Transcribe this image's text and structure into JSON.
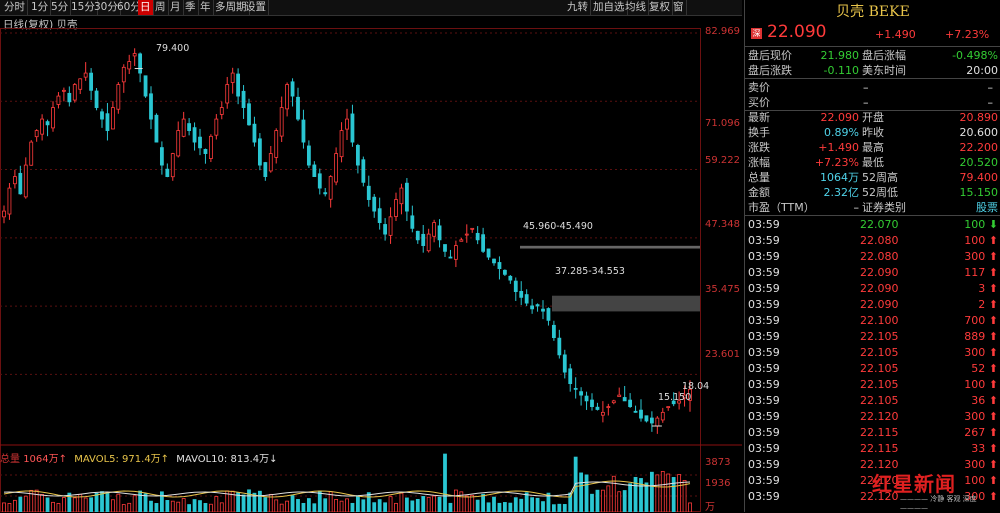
{
  "toolbar": {
    "left": [
      "分时",
      "1分",
      "5分",
      "15分",
      "30分",
      "60分",
      "日",
      "周",
      "月",
      "季",
      "年",
      "多周期",
      "设置"
    ],
    "active": "日",
    "right": [
      "九转",
      "加自选",
      "均线",
      "复权",
      "窗"
    ]
  },
  "chart": {
    "title": "日线(复权) 贝壳",
    "price_labels": [
      "82.969",
      "71.096",
      "59.222",
      "47.348",
      "35.475",
      "23.601"
    ],
    "annotations": {
      "high": "79.400",
      "low": "15.150",
      "last": "18.04",
      "gap1": "45.960-45.490",
      "gap2": "37.285-34.553"
    },
    "volume_legend": {
      "total_label": "总量",
      "total_value": "1064万↑",
      "mavol5": "MAVOL5: 971.4万↑",
      "mavol10": "MAVOL10: 813.4万↓"
    },
    "volume_labels": [
      "3873",
      "1936"
    ],
    "volume_unit": "万"
  },
  "chart_data": {
    "type": "candlestick",
    "title": "日线(复权) 贝壳",
    "ylim": [
      15.15,
      82.969
    ],
    "y_ticks": [
      82.969,
      71.096,
      59.222,
      47.348,
      35.475,
      23.601
    ],
    "series_close": [
      52,
      56,
      58,
      55,
      60,
      64,
      66,
      68,
      67,
      70,
      72,
      73,
      71,
      74,
      75,
      76,
      73,
      70,
      68,
      66,
      70,
      74,
      77,
      78,
      79.4,
      76,
      72,
      68,
      64,
      60,
      58,
      62,
      66,
      68,
      66,
      64,
      63,
      62,
      65,
      68,
      70,
      74,
      76,
      72,
      70,
      67,
      64,
      60,
      58,
      62,
      66,
      70,
      74,
      72,
      68,
      64,
      60,
      58,
      56,
      55,
      58,
      62,
      66,
      68,
      64,
      60,
      57,
      54,
      52,
      50,
      48,
      51,
      54,
      56,
      52,
      49,
      47,
      46,
      48,
      50,
      47,
      45,
      44,
      46,
      47,
      48,
      49,
      47,
      45,
      44,
      43,
      42,
      41,
      40,
      38,
      37,
      36,
      35,
      35.5,
      34.6,
      33,
      30,
      27,
      24,
      22,
      21,
      20,
      19,
      18,
      17.5,
      17,
      18,
      19,
      20,
      19,
      18,
      17,
      16,
      15.5,
      15.15,
      16,
      17,
      18,
      18.5,
      19,
      20,
      21
    ],
    "volume_ylim": [
      0,
      3873
    ],
    "volume_max_label": 3873
  },
  "panel": {
    "name": "贝壳 BEKE",
    "badge": "深",
    "price": "22.090",
    "change": "+1.490",
    "change_pct": "+7.23%",
    "after_hours": [
      {
        "l1": "盘后现价",
        "v1": "21.980",
        "l2": "盘后涨幅",
        "v2": "-0.498%"
      },
      {
        "l1": "盘后涨跌",
        "v1": "-0.110",
        "l2": "美东时间",
        "v2": "20:00"
      }
    ],
    "bid_ask": [
      {
        "label": "卖价",
        "v": "–",
        "v2": "–"
      },
      {
        "label": "买价",
        "v": "–",
        "v2": "–"
      }
    ],
    "stats": [
      {
        "l1": "最新",
        "v1": "22.090",
        "c1": "red",
        "l2": "开盘",
        "v2": "20.890",
        "c2": "red"
      },
      {
        "l1": "换手",
        "v1": "0.89%",
        "c1": "cyan",
        "l2": "昨收",
        "v2": "20.600",
        "c2": "white"
      },
      {
        "l1": "涨跌",
        "v1": "+1.490",
        "c1": "red",
        "l2": "最高",
        "v2": "22.200",
        "c2": "red"
      },
      {
        "l1": "涨幅",
        "v1": "+7.23%",
        "c1": "red",
        "l2": "最低",
        "v2": "20.520",
        "c2": "green"
      },
      {
        "l1": "总量",
        "v1": "1064万",
        "c1": "cyan",
        "l2": "52周高",
        "v2": "79.400",
        "c2": "red"
      },
      {
        "l1": "金额",
        "v1": "2.32亿",
        "c1": "cyan",
        "l2": "52周低",
        "v2": "15.150",
        "c2": "green"
      },
      {
        "l1": "市盈（TTM）",
        "v1": "–",
        "c1": "white",
        "l2": "证券类别",
        "v2": "股票",
        "c2": "cyan"
      }
    ],
    "trades": [
      {
        "t": "03:59",
        "p": "22.070",
        "v": "100",
        "d": "down"
      },
      {
        "t": "03:59",
        "p": "22.080",
        "v": "100",
        "d": "up"
      },
      {
        "t": "03:59",
        "p": "22.080",
        "v": "300",
        "d": "up"
      },
      {
        "t": "03:59",
        "p": "22.090",
        "v": "117",
        "d": "up"
      },
      {
        "t": "03:59",
        "p": "22.090",
        "v": "3",
        "d": "up"
      },
      {
        "t": "03:59",
        "p": "22.090",
        "v": "2",
        "d": "up"
      },
      {
        "t": "03:59",
        "p": "22.100",
        "v": "700",
        "d": "up"
      },
      {
        "t": "03:59",
        "p": "22.105",
        "v": "889",
        "d": "up"
      },
      {
        "t": "03:59",
        "p": "22.105",
        "v": "300",
        "d": "up"
      },
      {
        "t": "03:59",
        "p": "22.105",
        "v": "52",
        "d": "up"
      },
      {
        "t": "03:59",
        "p": "22.105",
        "v": "100",
        "d": "up"
      },
      {
        "t": "03:59",
        "p": "22.105",
        "v": "36",
        "d": "up"
      },
      {
        "t": "03:59",
        "p": "22.120",
        "v": "300",
        "d": "up"
      },
      {
        "t": "03:59",
        "p": "22.115",
        "v": "267",
        "d": "up"
      },
      {
        "t": "03:59",
        "p": "22.115",
        "v": "33",
        "d": "up"
      },
      {
        "t": "03:59",
        "p": "22.120",
        "v": "300",
        "d": "up"
      },
      {
        "t": "03:59",
        "p": "22.120",
        "v": "100",
        "d": "up"
      },
      {
        "t": "03:59",
        "p": "22.120",
        "v": "300",
        "d": "up"
      }
    ]
  },
  "watermark": {
    "main": "红星新闻",
    "sub": "———— 冷静 客观 深度 ————"
  }
}
